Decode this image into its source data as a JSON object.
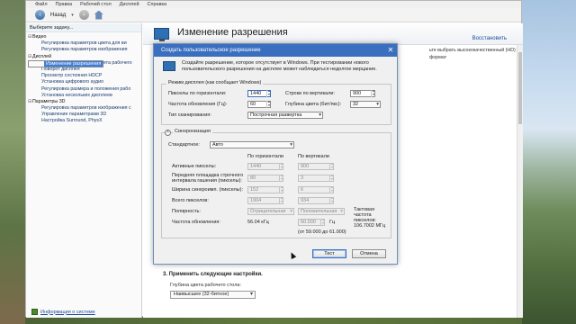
{
  "menu": [
    "Файл",
    "Правка",
    "Рабочий стол",
    "Дисплей",
    "Справка"
  ],
  "toolbar": {
    "back_label": "Назад"
  },
  "left_panel": {
    "task_header": "Выберите задачу...",
    "tree": [
      {
        "label": "Видео",
        "level": 0,
        "expander": "⊟"
      },
      {
        "label": "Регулировка параметров цвета для ви",
        "level": 1
      },
      {
        "label": "Регулировка параметров изображения",
        "level": 1
      },
      {
        "label": "Дисплей",
        "level": 0,
        "expander": "⊟"
      },
      {
        "label": "Изменение разрешения",
        "level": 1,
        "selected": true
      },
      {
        "label": "Регулировка параметров цвета рабочего",
        "level": 1
      },
      {
        "label": "Поворот дисплея",
        "level": 1
      },
      {
        "label": "Просмотр состояния HDCP",
        "level": 1
      },
      {
        "label": "Установка цифрового аудио",
        "level": 1
      },
      {
        "label": "Регулировка размера и положения рабо",
        "level": 1
      },
      {
        "label": "Установка нескольких дисплеев",
        "level": 1
      },
      {
        "label": "Параметры 3D",
        "level": 0,
        "expander": "⊟"
      },
      {
        "label": "Регулировка параметров изображения с",
        "level": 1
      },
      {
        "label": "Управление параметрами 3D",
        "level": 1
      },
      {
        "label": "Настройка Surround, PhysX",
        "level": 1
      }
    ],
    "system_info": "Информация о системе"
  },
  "content": {
    "title": "Изменение разрешения",
    "restore": "Восстановить",
    "description_fragment": "ьте выбрать высококачественный (HD) формат",
    "step3": "3. Применить следующие настройки.",
    "depth_label": "Глубина цвета рабочего стола:",
    "depth_value": "Наивысшее (32-битное)"
  },
  "dialog": {
    "title": "Создать пользовательское разрешение",
    "intro": "Создайте разрешение, которое отсутствует в Windows. При тестировании нового пользовательского разрешения на дисплее может наблюдаться недолгое мерцание.",
    "mode_group": "Режим дисплея (как сообщает Windows)",
    "h_pixels_label": "Пикселы по горизонтали:",
    "h_pixels_value": "1440",
    "v_lines_label": "Строки по вертикали:",
    "v_lines_value": "900",
    "refresh_label": "Частота обновления (Гц):",
    "refresh_value": "60",
    "color_depth_label": "Глубина цвета (бит/пкс):",
    "color_depth_value": "32",
    "scan_label": "Тип сканирования:",
    "scan_value": "Построчная развертка",
    "sync_group": "Синхронизация",
    "standard_label": "Стандартное:",
    "standard_value": "Авто",
    "col_horizontal": "По горизонтали",
    "col_vertical": "По вертикали",
    "active_label": "Активные пикселы:",
    "active_h": "1440",
    "active_v": "900",
    "front_porch_label": "Передняя площадка строчного интервала гашения (пикселы):",
    "front_porch_h": "80",
    "front_porch_v": "3",
    "sync_width_label": "Ширина синхроимп. (пикселы):",
    "sync_width_h": "152",
    "sync_width_v": "6",
    "total_label": "Всего пикселов:",
    "total_h": "1904",
    "total_v": "934",
    "polarity_label": "Полярность:",
    "polarity_h": "Отрицательная",
    "polarity_v": "Положительная",
    "refresh_rate_label": "Частота обновления:",
    "refresh_rate_khz": "56.04 кГц",
    "refresh_rate_hz": "60.000",
    "hz_unit": "Гц",
    "range": "(от 59.000 до 61.000)",
    "pixel_clock_label": "Тактовая частота пикселов:",
    "pixel_clock_value": "106.7002 МГц",
    "test_button": "Тест",
    "cancel_button": "Отмена"
  }
}
